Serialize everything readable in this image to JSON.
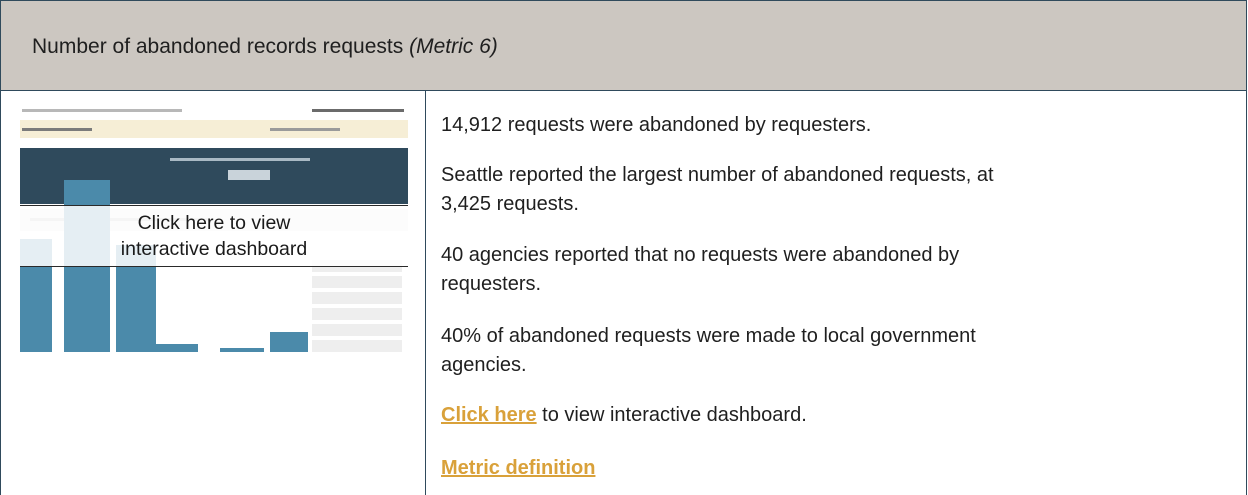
{
  "header": {
    "title": "Number of abandoned records requests",
    "metric_tag": "(Metric 6)"
  },
  "thumbnail": {
    "overlay_line1": "Click here to view",
    "overlay_line2": "interactive dashboard",
    "bar_values": [
      0.58,
      0.88,
      0.55,
      0.04,
      0.02,
      0.1
    ]
  },
  "findings": [
    "14,912 requests were abandoned by requesters.",
    "Seattle reported the largest number of abandoned requests, at",
    "3,425 requests.",
    "40 agencies reported that no requests were abandoned by",
    "requesters.",
    "40% of abandoned requests were made to local government",
    "agencies."
  ],
  "dashboard_link": {
    "link_text": "Click here",
    "rest_text": " to view interactive dashboard."
  },
  "metric_definition_link": "Metric definition",
  "colors": {
    "header_bg": "#ccc7c1",
    "border": "#2f4a5c",
    "link": "#d9a13a",
    "bar": "#4b8aaa"
  }
}
